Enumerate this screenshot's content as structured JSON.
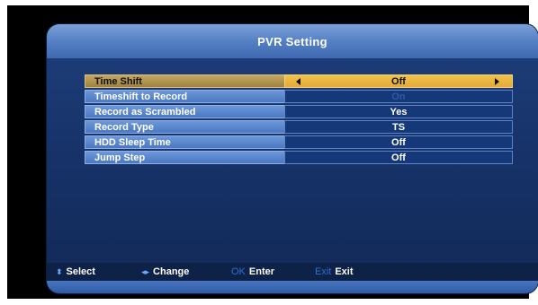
{
  "window": {
    "title": "PVR Setting"
  },
  "settings": [
    {
      "label": "Time Shift",
      "value": "Off",
      "selected": true,
      "disabled": false
    },
    {
      "label": "Timeshift to Record",
      "value": "On",
      "selected": false,
      "disabled": true
    },
    {
      "label": "Record as Scrambled",
      "value": "Yes",
      "selected": false,
      "disabled": false
    },
    {
      "label": "Record Type",
      "value": "TS",
      "selected": false,
      "disabled": false
    },
    {
      "label": "HDD Sleep Time",
      "value": "Off",
      "selected": false,
      "disabled": false
    },
    {
      "label": "Jump Step",
      "value": "Off",
      "selected": false,
      "disabled": false
    }
  ],
  "help": {
    "select": {
      "key": "⬍",
      "label": "Select"
    },
    "change": {
      "key": "◂▸",
      "label": "Change"
    },
    "enter": {
      "key": "OK",
      "label": "Enter"
    },
    "exit": {
      "key": "Exit",
      "label": "Exit"
    }
  },
  "colors": {
    "highlight_value": "#f1c34a",
    "highlight_label": "#c4a760",
    "label_bg": "#5a86cf",
    "value_bg": "#153878",
    "panel_bg": "#17336a"
  }
}
